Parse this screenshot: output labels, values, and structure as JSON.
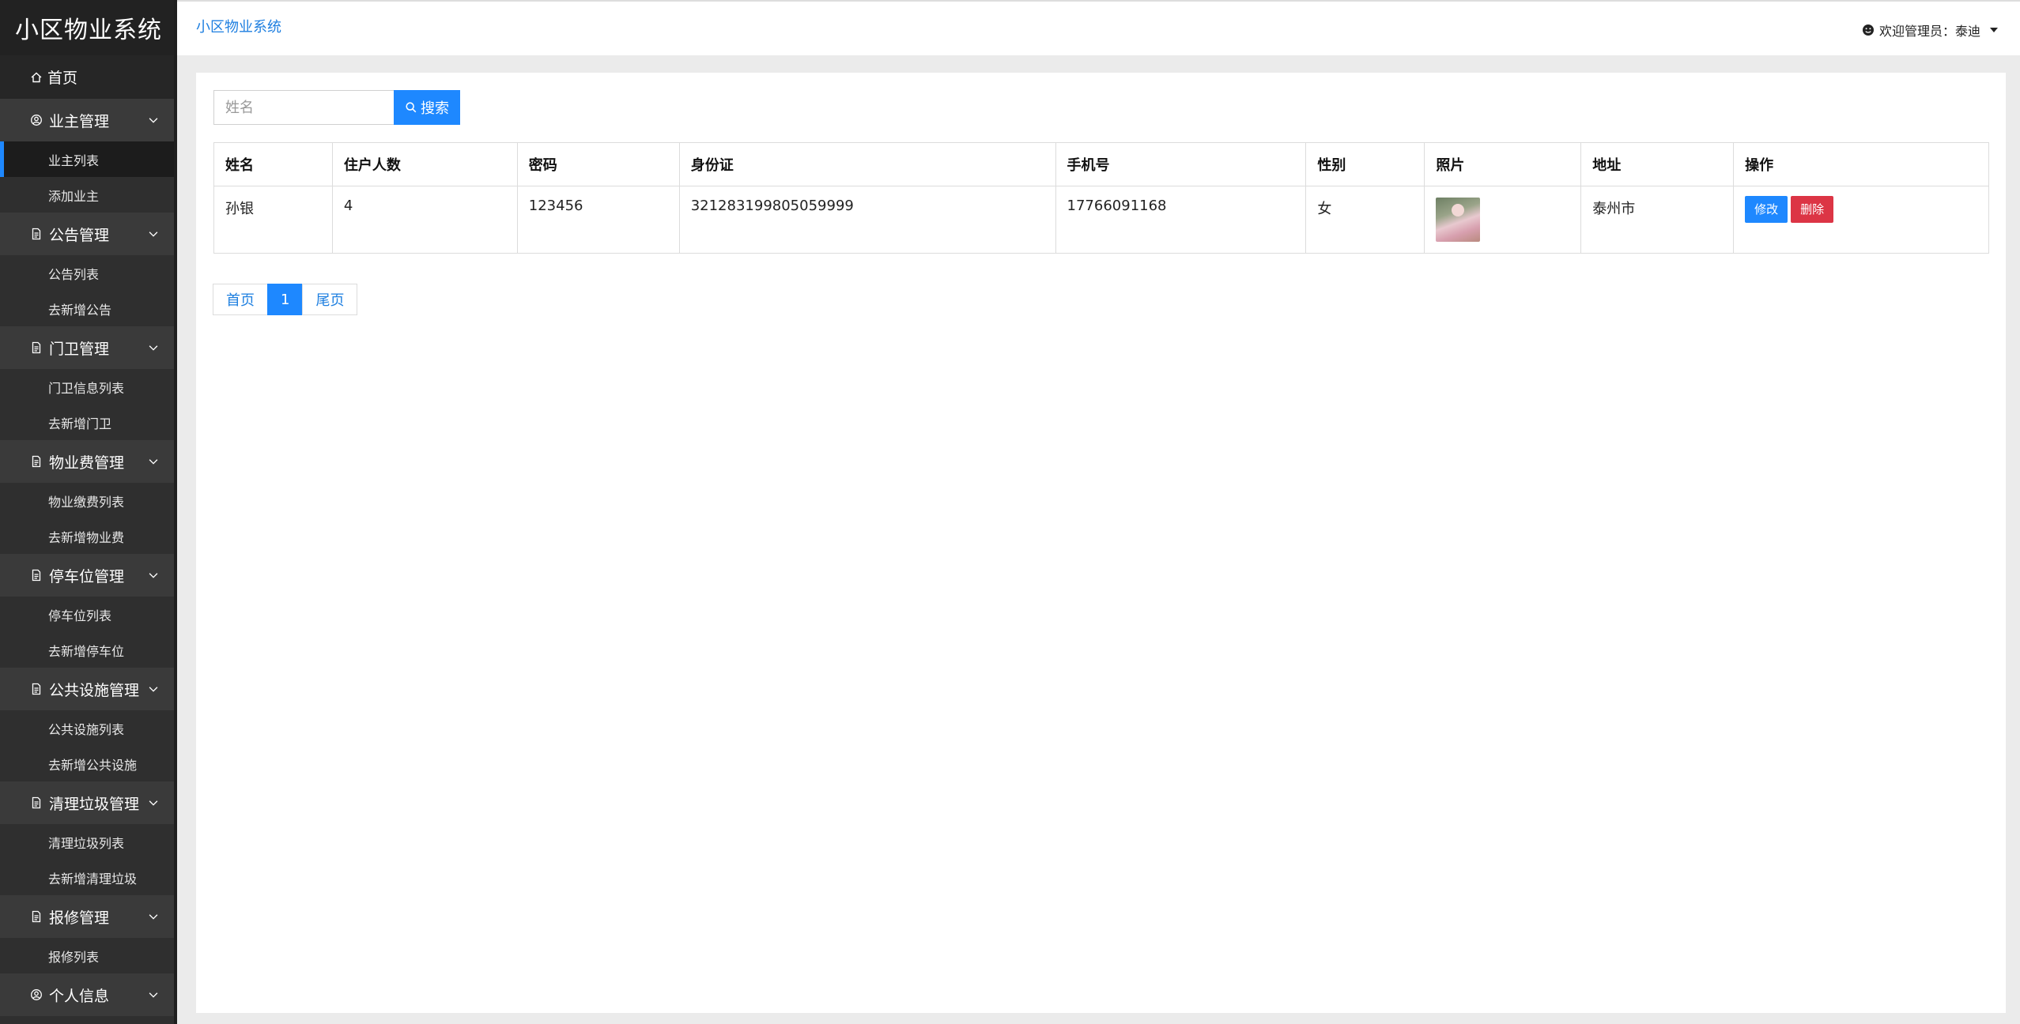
{
  "sidebar": {
    "brand": "小区物业系统",
    "home": "首页",
    "groups": [
      {
        "label": "业主管理",
        "items": [
          "业主列表",
          "添加业主"
        ]
      },
      {
        "label": "公告管理",
        "items": [
          "公告列表",
          "去新增公告"
        ]
      },
      {
        "label": "门卫管理",
        "items": [
          "门卫信息列表",
          "去新增门卫"
        ]
      },
      {
        "label": "物业费管理",
        "items": [
          "物业缴费列表",
          "去新增物业费"
        ]
      },
      {
        "label": "停车位管理",
        "items": [
          "停车位列表",
          "去新增停车位"
        ]
      },
      {
        "label": "公共设施管理",
        "items": [
          "公共设施列表",
          "去新增公共设施"
        ]
      },
      {
        "label": "清理垃圾管理",
        "items": [
          "清理垃圾列表",
          "去新增清理垃圾"
        ]
      },
      {
        "label": "报修管理",
        "items": [
          "报修列表"
        ]
      },
      {
        "label": "个人信息",
        "items": []
      }
    ]
  },
  "header": {
    "title": "小区物业系统",
    "welcome": "欢迎管理员：泰迪"
  },
  "search": {
    "placeholder": "姓名",
    "value": "",
    "button": "搜索"
  },
  "table": {
    "columns": [
      "姓名",
      "住户人数",
      "密码",
      "身份证",
      "手机号",
      "性别",
      "照片",
      "地址",
      "操作"
    ],
    "rows": [
      {
        "name": "孙银",
        "residents": "4",
        "password": "123456",
        "id_card": "321283199805059999",
        "phone": "17766091168",
        "gender": "女",
        "address": "泰州市"
      }
    ],
    "edit_label": "修改",
    "delete_label": "删除"
  },
  "pager": {
    "first": "首页",
    "current": "1",
    "last": "尾页"
  },
  "colors": {
    "accent": "#1e88ff",
    "danger": "#dc3545",
    "sidebar_bg": "#2f2f2f",
    "sidebar_header": "#3a3a3a"
  }
}
